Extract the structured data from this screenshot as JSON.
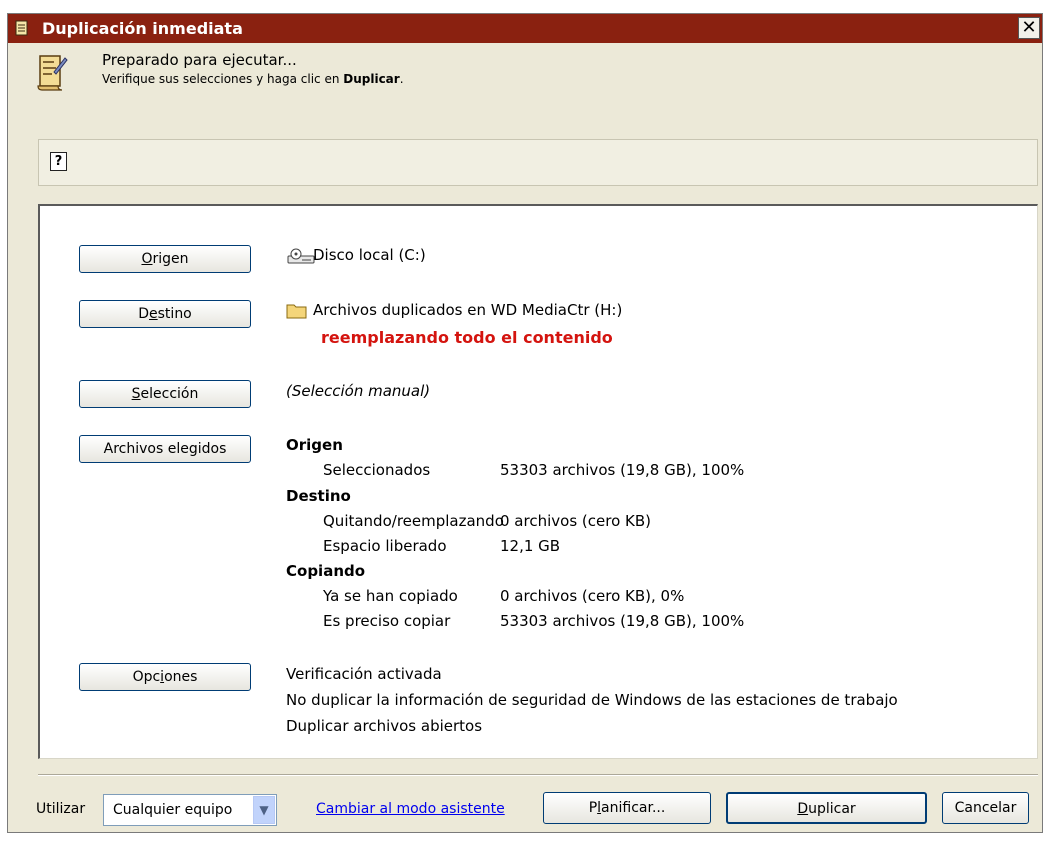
{
  "window": {
    "title": "Duplicación inmediata",
    "close_label": "✕"
  },
  "header": {
    "title": "Preparado para ejecutar...",
    "subtitle_prefix": "Verifique sus selecciones y haga clic en ",
    "subtitle_bold": "Duplicar",
    "subtitle_suffix": "."
  },
  "help": {
    "icon_label": "?"
  },
  "sections": {
    "origen_button": {
      "pre": "",
      "ul": "O",
      "post": "rigen"
    },
    "origen_value": "Disco local (C:)",
    "destino_button": {
      "pre": "D",
      "ul": "e",
      "post": "stino"
    },
    "destino_value": "Archivos duplicados en WD MediaCtr (H:)",
    "destino_warning": "reemplazando todo el contenido",
    "seleccion_button": {
      "pre": "",
      "ul": "S",
      "post": "elección"
    },
    "seleccion_value": "(Selección manual)",
    "archivos_button": "Archivos elegidos",
    "opciones_button": {
      "pre": "Opc",
      "ul": "i",
      "post": "ones"
    }
  },
  "summary": {
    "origen_heading": "Origen",
    "seleccionados_label": "Seleccionados",
    "seleccionados_value": "53303 archivos (19,8 GB), 100%",
    "destino_heading": "Destino",
    "quitando_label": "Quitando/reemplazando",
    "quitando_value": "0 archivos (cero KB)",
    "espacio_label": "Espacio liberado",
    "espacio_value": "12,1 GB",
    "copiando_heading": "Copiando",
    "copiado_label": "Ya se han copiado",
    "copiado_value": "0 archivos (cero KB), 0%",
    "preciso_label": "Es preciso copiar",
    "preciso_value": "53303 archivos (19,8 GB), 100%"
  },
  "options": {
    "line1": "Verificación activada",
    "line2": "No duplicar la información de seguridad de Windows de las estaciones de trabajo",
    "line3": "Duplicar archivos abiertos"
  },
  "footer": {
    "utilizar_label": "Utilizar",
    "equipo_value": "Cualquier equipo",
    "wizard_link": "Cambiar al modo asistente",
    "planificar": {
      "pre": "P",
      "ul": "l",
      "post": "anificar..."
    },
    "duplicar": {
      "pre": "",
      "ul": "D",
      "post": "uplicar"
    },
    "cancelar": "Cancelar"
  },
  "colors": {
    "titlebar": "#8a2110",
    "warning": "#d4140f",
    "link": "#0000ee",
    "window_bg": "#ece9d8"
  }
}
